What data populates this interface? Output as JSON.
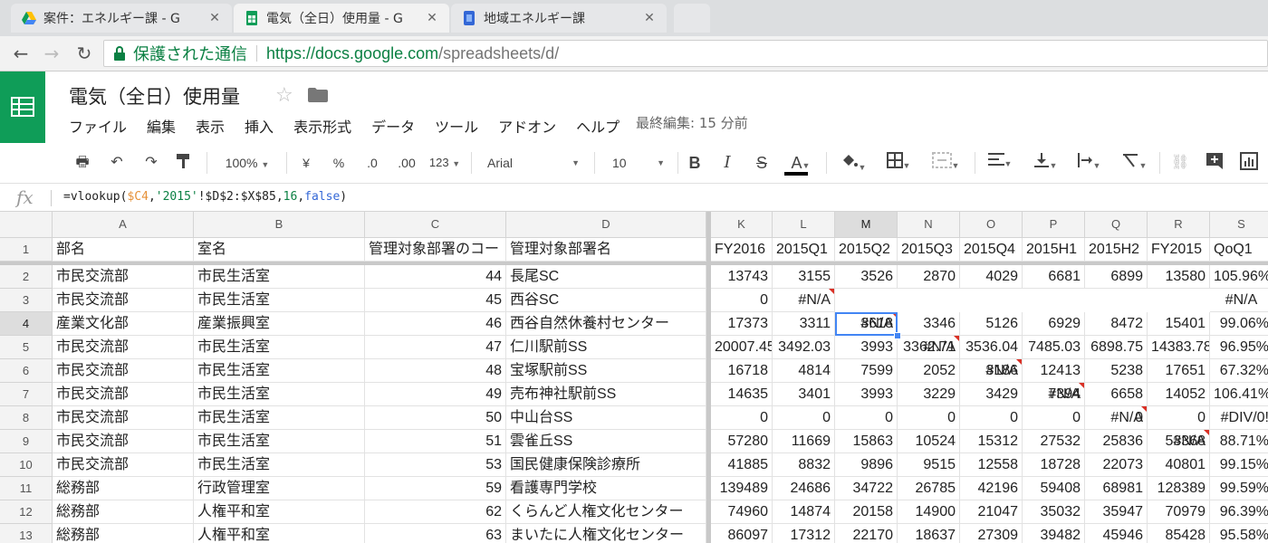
{
  "browser": {
    "tabs": [
      {
        "title": "案件：エネルギー課 - G",
        "icon": "drive-icon"
      },
      {
        "title": "電気（全日）使用量 - G",
        "icon": "sheets-icon"
      },
      {
        "title": "地域エネルギー課",
        "icon": "sites-icon"
      }
    ],
    "secure_label": "保護された通信",
    "url_host": "https://docs.google.com",
    "url_path": "/spreadsheets/d/"
  },
  "doc": {
    "title": "電気（全日）使用量",
    "menu": [
      "ファイル",
      "編集",
      "表示",
      "挿入",
      "表示形式",
      "データ",
      "ツール",
      "アドオン",
      "ヘルプ"
    ],
    "last_edit": "最終編集: 15 分前"
  },
  "toolbar": {
    "zoom": "100%",
    "currency": "¥",
    "percent": "%",
    "dec_less": ".0",
    "dec_more": ".00",
    "more_formats": "123",
    "font": "Arial",
    "font_size": "10",
    "bold": "B",
    "italic": "I",
    "strike": "S",
    "text_color": "A"
  },
  "formula": {
    "fx": "fx",
    "parts": {
      "p1": "=vlookup(",
      "p2": "$C4",
      "p3": ",",
      "p4": "'2015'",
      "p5": "!$D$2:$X$85,",
      "p6": "16",
      "p7": ",",
      "p8": "false",
      "p9": ")"
    }
  },
  "sheet": {
    "columns": [
      "A",
      "B",
      "C",
      "D",
      "K",
      "L",
      "M",
      "N",
      "O",
      "P",
      "Q",
      "R",
      "S"
    ],
    "header": [
      "部名",
      "室名",
      "管理対象部署のコー",
      "管理対象部署名",
      "FY2016",
      "2015Q1",
      "2015Q2",
      "2015Q3",
      "2015Q4",
      "2015H1",
      "2015H2",
      "FY2015",
      "QoQ1"
    ],
    "rows": [
      {
        "n": "2",
        "cells": [
          "市民交流部",
          "市民生活室",
          "44",
          "長尾SC",
          "13743",
          "3155",
          "3526",
          "2870",
          "4029",
          "6681",
          "6899",
          "13580",
          "105.96%"
        ]
      },
      {
        "n": "3",
        "cells": [
          "市民交流部",
          "市民生活室",
          "45",
          "西谷SC",
          "0",
          "#N/A",
          "#N/A",
          "#N/A",
          "#N/A",
          "#N/A",
          "#N/A",
          "#N/A",
          "#N/A"
        ]
      },
      {
        "n": "4",
        "cells": [
          "産業文化部",
          "産業振興室",
          "46",
          "西谷自然休養村センター",
          "17373",
          "3311",
          "3618",
          "3346",
          "5126",
          "6929",
          "8472",
          "15401",
          "99.06%"
        ]
      },
      {
        "n": "5",
        "cells": [
          "市民交流部",
          "市民生活室",
          "47",
          "仁川駅前SS",
          "20007.45",
          "3492.03",
          "3993",
          "3362.71",
          "3536.04",
          "7485.03",
          "6898.75",
          "14383.78",
          "96.95%"
        ]
      },
      {
        "n": "6",
        "cells": [
          "市民交流部",
          "市民生活室",
          "48",
          "宝塚駅前SS",
          "16718",
          "4814",
          "7599",
          "2052",
          "3186",
          "12413",
          "5238",
          "17651",
          "67.32%"
        ]
      },
      {
        "n": "7",
        "cells": [
          "市民交流部",
          "市民生活室",
          "49",
          "売布神社駅前SS",
          "14635",
          "3401",
          "3993",
          "3229",
          "3429",
          "7394",
          "6658",
          "14052",
          "106.41%"
        ]
      },
      {
        "n": "8",
        "cells": [
          "市民交流部",
          "市民生活室",
          "50",
          "中山台SS",
          "0",
          "0",
          "0",
          "0",
          "0",
          "0",
          "0",
          "0",
          "#DIV/0!"
        ]
      },
      {
        "n": "9",
        "cells": [
          "市民交流部",
          "市民生活室",
          "51",
          "雲雀丘SS",
          "57280",
          "11669",
          "15863",
          "10524",
          "15312",
          "27532",
          "25836",
          "53368",
          "88.71%"
        ]
      },
      {
        "n": "10",
        "cells": [
          "市民交流部",
          "市民生活室",
          "53",
          "国民健康保険診療所",
          "41885",
          "8832",
          "9896",
          "9515",
          "12558",
          "18728",
          "22073",
          "40801",
          "99.15%"
        ]
      },
      {
        "n": "11",
        "cells": [
          "総務部",
          "行政管理室",
          "59",
          "看護専門学校",
          "139489",
          "24686",
          "34722",
          "26785",
          "42196",
          "59408",
          "68981",
          "128389",
          "99.59%"
        ]
      },
      {
        "n": "12",
        "cells": [
          "総務部",
          "人権平和室",
          "62",
          "くらんど人権文化センター",
          "74960",
          "14874",
          "20158",
          "14900",
          "21047",
          "35032",
          "35947",
          "70979",
          "96.39%"
        ]
      },
      {
        "n": "13",
        "cells": [
          "総務部",
          "人権平和室",
          "63",
          "まいたに人権文化センター",
          "86097",
          "17312",
          "22170",
          "18637",
          "27309",
          "39482",
          "45946",
          "85428",
          "95.58%"
        ]
      }
    ]
  }
}
